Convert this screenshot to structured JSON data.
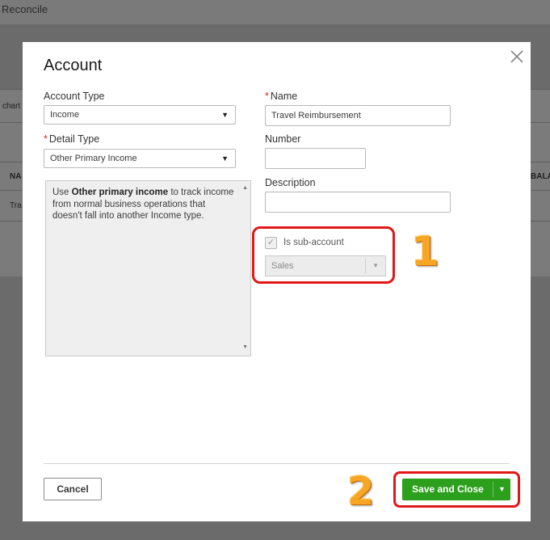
{
  "background": {
    "top_label": "Reconcile",
    "side_texts": [
      "chart",
      "NA",
      "Tra",
      "BALA"
    ]
  },
  "modal": {
    "title": "Account",
    "account_type": {
      "label": "Account Type",
      "value": "Income"
    },
    "detail_type": {
      "label": "Detail Type",
      "value": "Other Primary Income",
      "required_mark": "*"
    },
    "description_help": {
      "pre": "Use ",
      "bold": "Other primary income",
      "post": " to track income from normal business operations that doesn't fall into another Income type."
    },
    "name": {
      "label": "Name",
      "value": "Travel Reimbursement",
      "required_mark": "*"
    },
    "number": {
      "label": "Number",
      "value": ""
    },
    "description": {
      "label": "Description",
      "value": ""
    },
    "sub_account": {
      "label": "Is sub-account",
      "checked": true,
      "parent_value": "Sales"
    },
    "buttons": {
      "cancel": "Cancel",
      "save": "Save and Close"
    }
  },
  "annotations": {
    "step1": "1",
    "step2": "2"
  },
  "colors": {
    "primary_green": "#2ca01c",
    "highlight_red": "#e01818",
    "step_orange": "#f6a623"
  }
}
